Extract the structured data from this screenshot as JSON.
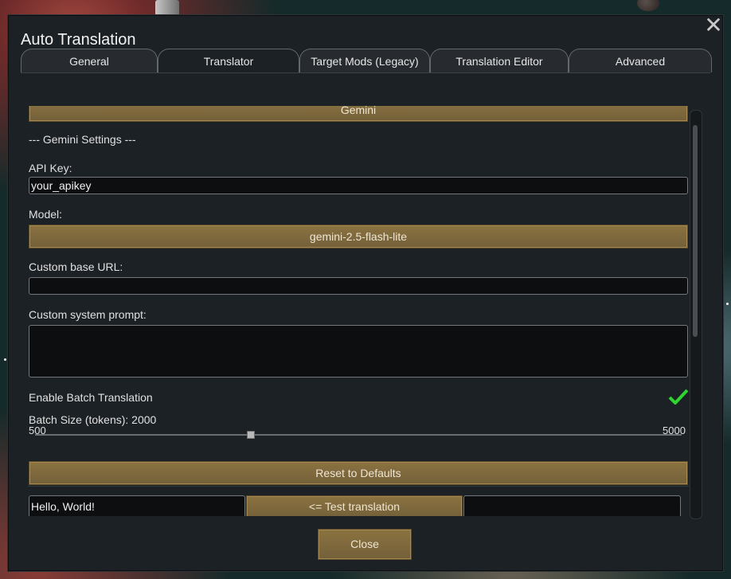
{
  "window": {
    "title": "Auto Translation"
  },
  "tabs": [
    {
      "label": "General"
    },
    {
      "label": "Translator"
    },
    {
      "label": "Target Mods (Legacy)"
    },
    {
      "label": "Translation Editor"
    },
    {
      "label": "Advanced"
    }
  ],
  "active_tab": "Translator",
  "translator": {
    "provider_button": "Gemini",
    "section_header": "--- Gemini Settings ---",
    "api_key": {
      "label": "API Key:",
      "value": "your_apikey"
    },
    "model": {
      "label": "Model:",
      "value": "gemini-2.5-flash-lite"
    },
    "custom_base_url": {
      "label": "Custom base URL:",
      "value": ""
    },
    "custom_system_prompt": {
      "label": "Custom system prompt:",
      "value": ""
    },
    "enable_batch": {
      "label": "Enable Batch Translation",
      "checked": true,
      "check_color": "#2fd52f"
    },
    "batch_size": {
      "label": "Batch Size (tokens): 2000",
      "min_label": "500",
      "max_label": "5000",
      "value": 2000,
      "min": 500,
      "max": 5000
    },
    "reset_button": "Reset to Defaults",
    "test": {
      "input_value": "Hello, World!",
      "button": "<= Test translation",
      "output_value": ""
    }
  },
  "footer": {
    "close_button": "Close"
  },
  "colors": {
    "accent_gold": "#7b6436",
    "window_bg": "#1c2126",
    "field_bg": "#0d0e10"
  }
}
